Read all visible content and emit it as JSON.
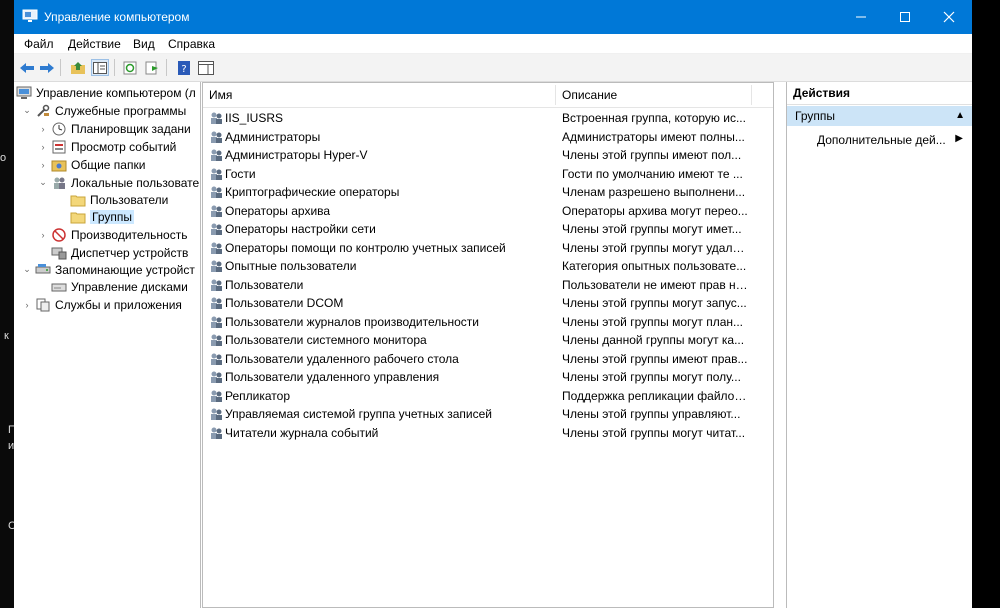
{
  "desktop": {
    "chars": [
      "о",
      "к",
      "П",
      "и",
      "С"
    ]
  },
  "window": {
    "title": "Управление компьютером",
    "controls": {
      "minimize": "—",
      "maximize": "☐",
      "close": "✕"
    }
  },
  "menu": [
    "Файл",
    "Действие",
    "Вид",
    "Справка"
  ],
  "tree": {
    "root": "Управление компьютером (л",
    "items": [
      {
        "label": "Служебные программы",
        "icon": "tools-icon"
      },
      {
        "label": "Планировщик задани",
        "icon": "clock-icon"
      },
      {
        "label": "Просмотр событий",
        "icon": "event-viewer-icon"
      },
      {
        "label": "Общие папки",
        "icon": "shared-folder-icon"
      },
      {
        "label": "Локальные пользовате",
        "icon": "users-icon"
      },
      {
        "label": "Пользователи",
        "icon": "folder-icon"
      },
      {
        "label": "Группы",
        "icon": "folder-icon"
      },
      {
        "label": "Производительность",
        "icon": "performance-icon"
      },
      {
        "label": "Диспетчер устройств",
        "icon": "device-manager-icon"
      },
      {
        "label": "Запоминающие устройст",
        "icon": "storage-icon"
      },
      {
        "label": "Управление дисками",
        "icon": "disk-icon"
      },
      {
        "label": "Службы и приложения",
        "icon": "services-icon"
      }
    ]
  },
  "list": {
    "columns": {
      "name": "Имя",
      "description": "Описание"
    },
    "rows": [
      {
        "name": "IIS_IUSRS",
        "description": "Встроенная группа, которую ис..."
      },
      {
        "name": "Администраторы",
        "description": "Администраторы имеют полны..."
      },
      {
        "name": "Администраторы Hyper-V",
        "description": "Члены этой группы имеют пол..."
      },
      {
        "name": "Гости",
        "description": "Гости по умолчанию имеют те ..."
      },
      {
        "name": "Криптографические операторы",
        "description": "Членам разрешено выполнени..."
      },
      {
        "name": "Операторы архива",
        "description": "Операторы архива могут перео..."
      },
      {
        "name": "Операторы настройки сети",
        "description": "Члены этой группы могут имет..."
      },
      {
        "name": "Операторы помощи по контролю учетных записей",
        "description": "Члены этой группы могут удале..."
      },
      {
        "name": "Опытные пользователи",
        "description": "Категория опытных пользовате..."
      },
      {
        "name": "Пользователи",
        "description": "Пользователи не имеют прав на..."
      },
      {
        "name": "Пользователи DCOM",
        "description": "Члены этой группы могут запус..."
      },
      {
        "name": "Пользователи журналов производительности",
        "description": "Члены этой группы могут план..."
      },
      {
        "name": "Пользователи системного монитора",
        "description": "Члены данной группы могут ка..."
      },
      {
        "name": "Пользователи удаленного рабочего стола",
        "description": "Члены этой группы имеют прав..."
      },
      {
        "name": "Пользователи удаленного управления",
        "description": "Члены этой группы могут полу..."
      },
      {
        "name": "Репликатор",
        "description": "Поддержка репликации файлов..."
      },
      {
        "name": "Управляемая системой группа учетных записей",
        "description": "Члены этой группы управляют..."
      },
      {
        "name": "Читатели журнала событий",
        "description": "Члены этой группы могут читат..."
      }
    ]
  },
  "actions": {
    "header": "Действия",
    "group": "Группы",
    "more": "Дополнительные дей...",
    "collapse_arrow": "▲",
    "more_arrow": "▶"
  },
  "colors": {
    "titlebar": "#0078d7",
    "selection": "#cce8ff",
    "actions_group": "#cce4f7"
  }
}
